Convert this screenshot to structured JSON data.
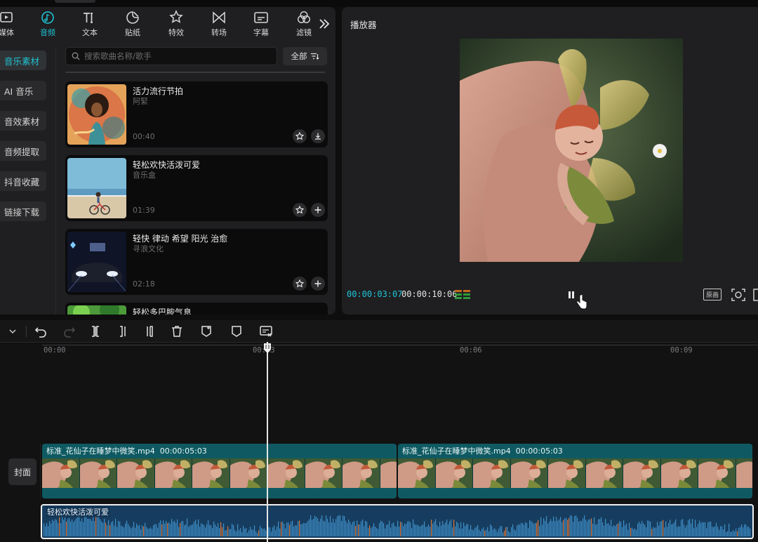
{
  "toolbar": {
    "tabs": [
      {
        "label": "媒体",
        "icon": "media-icon"
      },
      {
        "label": "音频",
        "icon": "audio-icon",
        "active": true
      },
      {
        "label": "文本",
        "icon": "text-icon"
      },
      {
        "label": "贴纸",
        "icon": "sticker-icon"
      },
      {
        "label": "特效",
        "icon": "effects-icon"
      },
      {
        "label": "转场",
        "icon": "transition-icon"
      },
      {
        "label": "字幕",
        "icon": "caption-icon"
      },
      {
        "label": "滤镜",
        "icon": "filter-icon"
      }
    ]
  },
  "sidebar": {
    "items": [
      {
        "label": "音乐素材",
        "active": true
      },
      {
        "label": "AI 音乐"
      },
      {
        "label": "音效素材"
      },
      {
        "label": "音频提取"
      },
      {
        "label": "抖音收藏"
      },
      {
        "label": "链接下载"
      }
    ]
  },
  "search": {
    "placeholder": "搜索歌曲名称/歌手",
    "filter_label": "全部"
  },
  "music_list": [
    {
      "title": "活力流行节拍",
      "artist": "阿緊",
      "duration": "00:40",
      "actions": [
        "favorite-icon",
        "download-icon"
      ]
    },
    {
      "title": "轻松欢快活泼可爱",
      "artist": "音乐盒",
      "duration": "01:39",
      "actions": [
        "favorite-icon",
        "add-icon"
      ]
    },
    {
      "title": "轻快 律动 希望 阳光 治愈",
      "artist": "寻浪文化",
      "duration": "02:18",
      "actions": [
        "favorite-icon",
        "add-icon"
      ]
    },
    {
      "title": "轻松多巴胺气息"
    }
  ],
  "player": {
    "title": "播放器",
    "current_time": "00:00:03:07",
    "total_time": "00:00:10:06",
    "ratio_label": "原画"
  },
  "timeline": {
    "ruler_labels": [
      "00:00",
      "00:03",
      "00:06",
      "00:09"
    ],
    "cover_label": "封面",
    "video_clips": [
      {
        "name": "标准_花仙子在睡梦中微笑.mp4",
        "duration": "00:00:05:03"
      },
      {
        "name": "标准_花仙子在睡梦中微笑.mp4",
        "duration": "00:00:05:03"
      }
    ],
    "audio_clip": {
      "name": "轻松欢快活泼可爱"
    }
  },
  "colors": {
    "accent": "#1fc3d3",
    "video_clip": "#0f5a62",
    "audio_clip": "#163d5f",
    "background": "#1f1f21"
  }
}
